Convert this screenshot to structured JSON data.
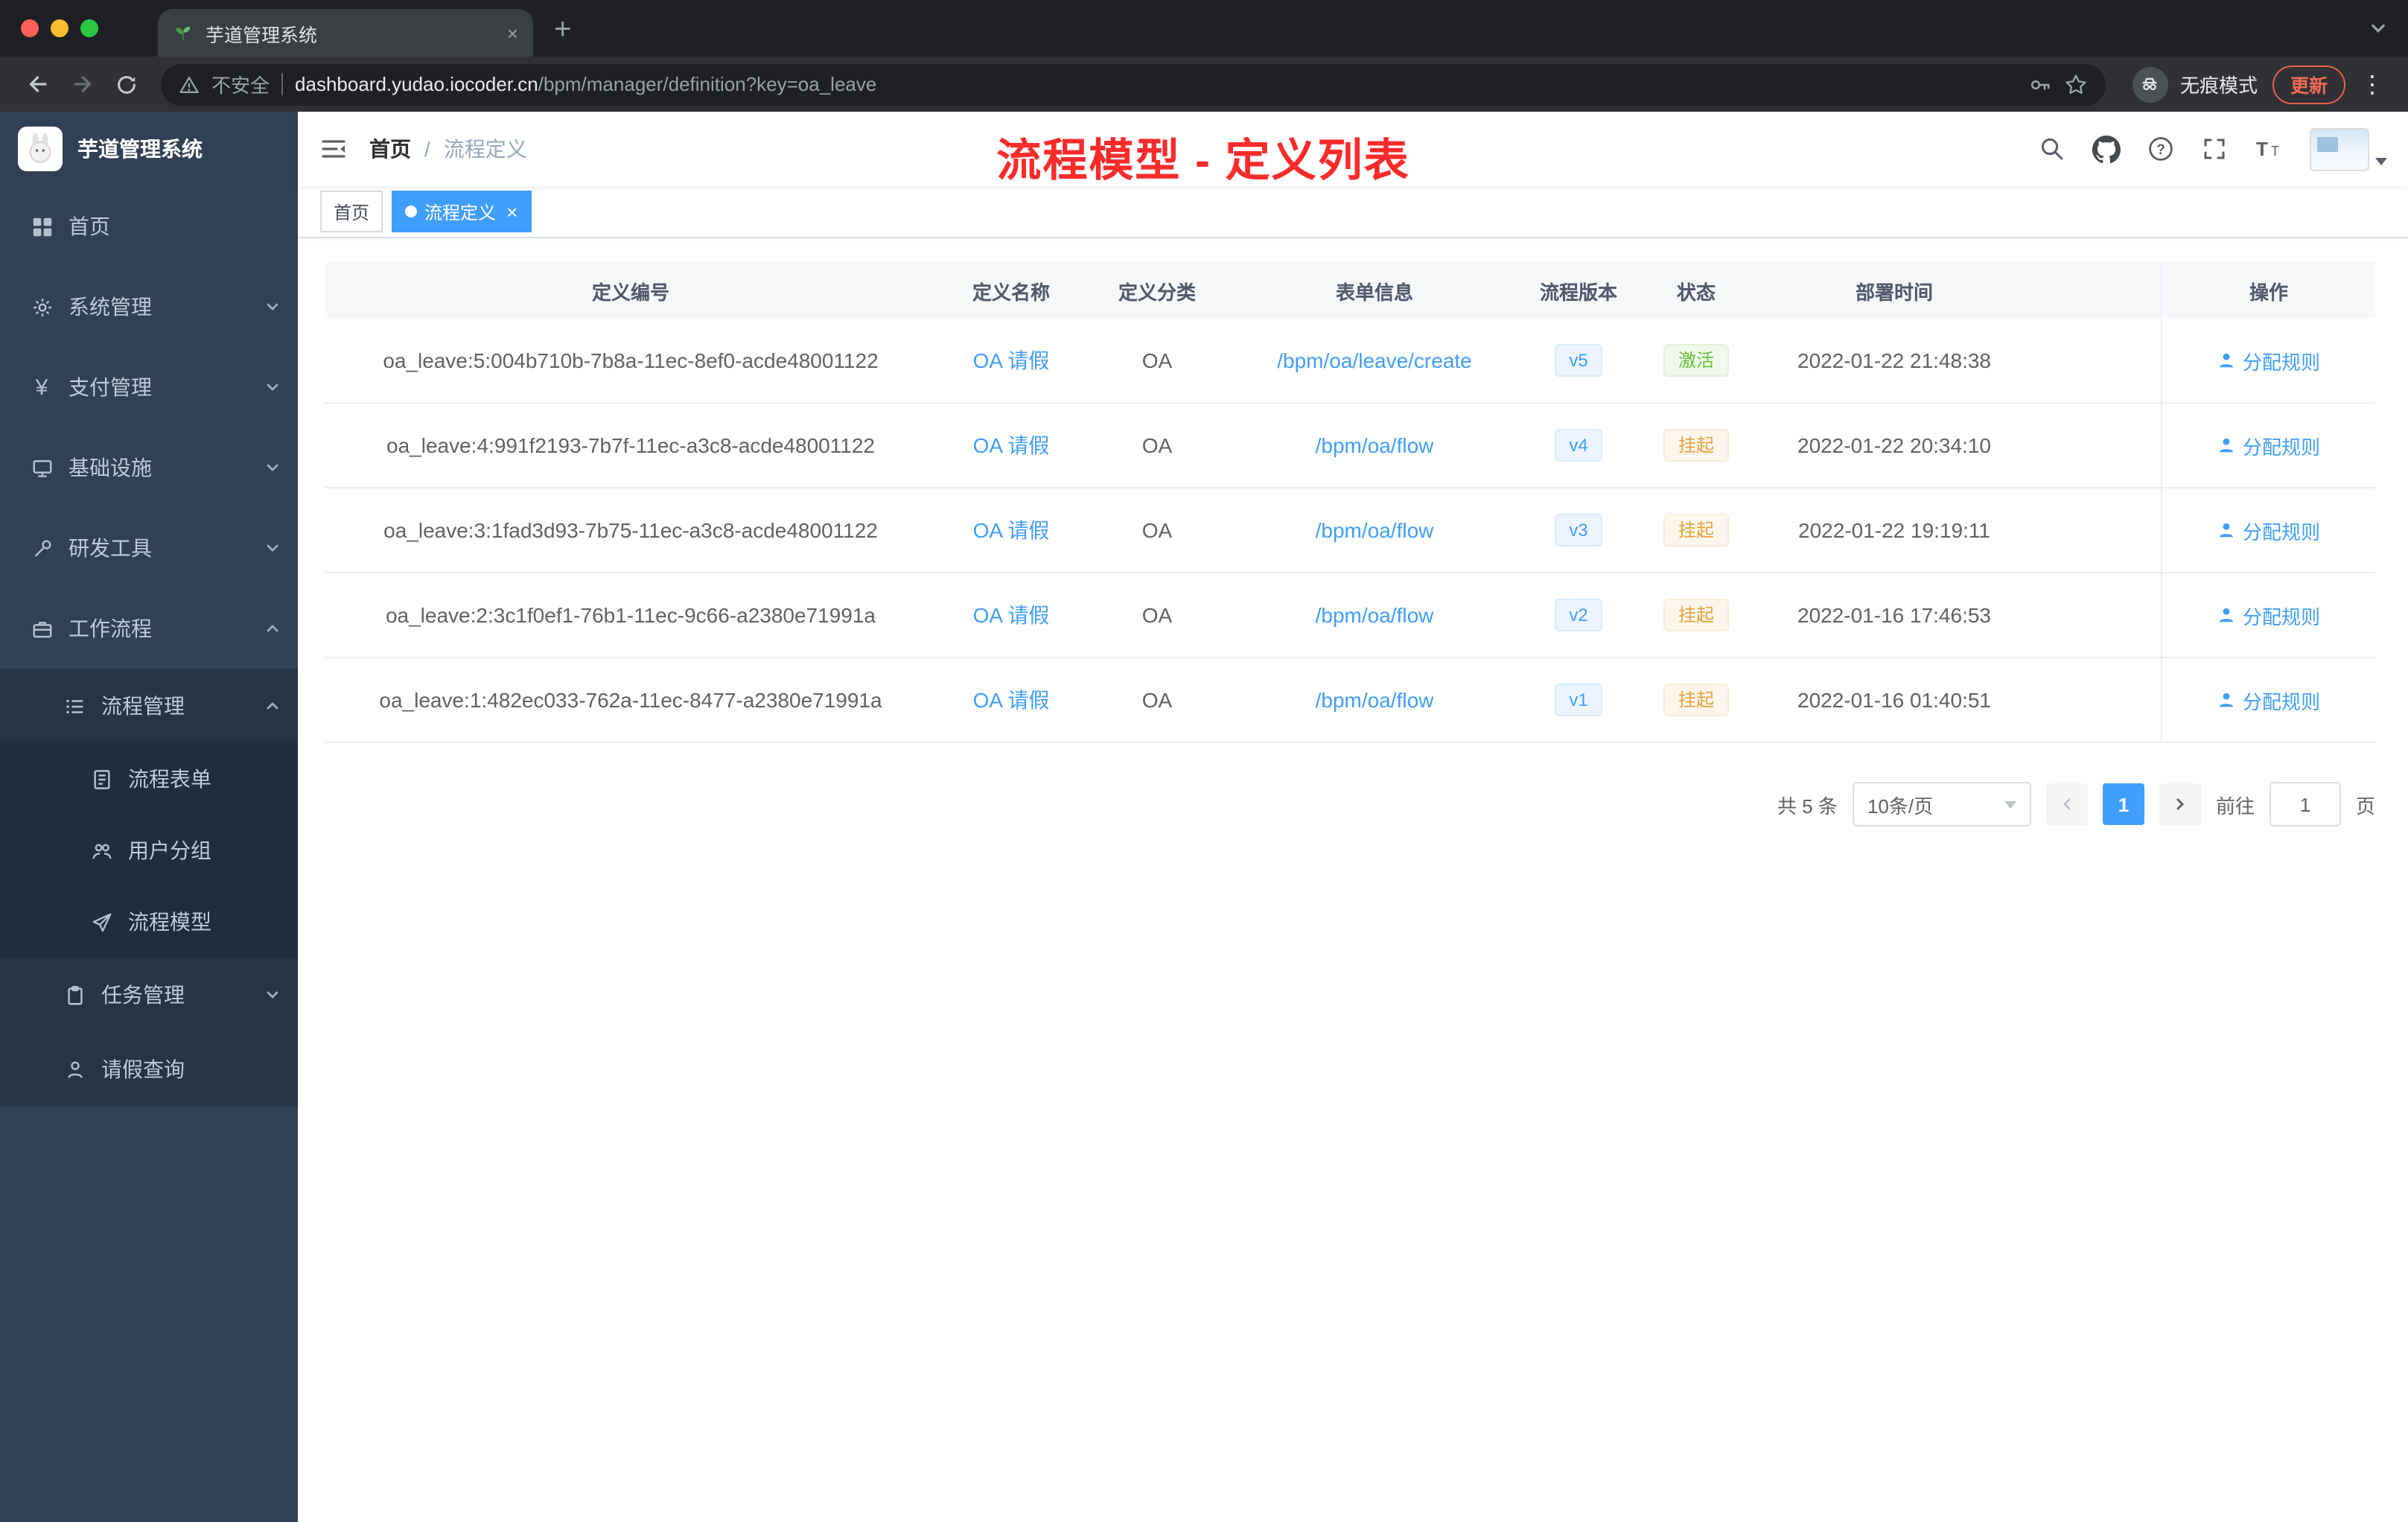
{
  "browser": {
    "tab_title": "芋道管理系统",
    "security_label": "不安全",
    "url_domain": "dashboard.yudao.iocoder.cn",
    "url_path": "/bpm/manager/definition?key=oa_leave",
    "incognito_label": "无痕模式",
    "update_label": "更新"
  },
  "icons": {
    "new_tab": "+",
    "close": "×",
    "kebab": "⋮",
    "yen": "¥",
    "question": "?"
  },
  "sidebar": {
    "title": "芋道管理系统",
    "items": [
      {
        "label": "首页"
      },
      {
        "label": "系统管理"
      },
      {
        "label": "支付管理"
      },
      {
        "label": "基础设施"
      },
      {
        "label": "研发工具"
      },
      {
        "label": "工作流程"
      },
      {
        "label": "流程管理"
      },
      {
        "label": "流程表单"
      },
      {
        "label": "用户分组"
      },
      {
        "label": "流程模型"
      },
      {
        "label": "任务管理"
      },
      {
        "label": "请假查询"
      }
    ]
  },
  "header": {
    "breadcrumb_home": "首页",
    "breadcrumb_sep": "/",
    "breadcrumb_current": "流程定义",
    "annotation": "流程模型 - 定义列表"
  },
  "tags": {
    "home": "首页",
    "active": "流程定义"
  },
  "table": {
    "columns": [
      "定义编号",
      "定义名称",
      "定义分类",
      "表单信息",
      "流程版本",
      "状态",
      "部署时间",
      "操作"
    ],
    "rows": [
      {
        "id": "oa_leave:5:004b710b-7b8a-11ec-8ef0-acde48001122",
        "name": "OA 请假",
        "category": "OA",
        "form": "/bpm/oa/leave/create",
        "version": "v5",
        "status": "激活",
        "time": "2022-01-22 21:48:38",
        "action": "分配规则"
      },
      {
        "id": "oa_leave:4:991f2193-7b7f-11ec-a3c8-acde48001122",
        "name": "OA 请假",
        "category": "OA",
        "form": "/bpm/oa/flow",
        "version": "v4",
        "status": "挂起",
        "time": "2022-01-22 20:34:10",
        "action": "分配规则"
      },
      {
        "id": "oa_leave:3:1fad3d93-7b75-11ec-a3c8-acde48001122",
        "name": "OA 请假",
        "category": "OA",
        "form": "/bpm/oa/flow",
        "version": "v3",
        "status": "挂起",
        "time": "2022-01-22 19:19:11",
        "action": "分配规则"
      },
      {
        "id": "oa_leave:2:3c1f0ef1-76b1-11ec-9c66-a2380e71991a",
        "name": "OA 请假",
        "category": "OA",
        "form": "/bpm/oa/flow",
        "version": "v2",
        "status": "挂起",
        "time": "2022-01-16 17:46:53",
        "action": "分配规则"
      },
      {
        "id": "oa_leave:1:482ec033-762a-11ec-8477-a2380e71991a",
        "name": "OA 请假",
        "category": "OA",
        "form": "/bpm/oa/flow",
        "version": "v1",
        "status": "挂起",
        "time": "2022-01-16 01:40:51",
        "action": "分配规则"
      }
    ]
  },
  "pagination": {
    "total": "共 5 条",
    "page_size": "10条/页",
    "page": "1",
    "goto_label": "前往",
    "goto_value": "1",
    "goto_unit": "页"
  },
  "colors": {
    "primary": "#409eff",
    "success": "#67c23a",
    "warning": "#e6a23c",
    "annotation_red": "#fb2b2b",
    "sidebar_bg": "#304156"
  }
}
